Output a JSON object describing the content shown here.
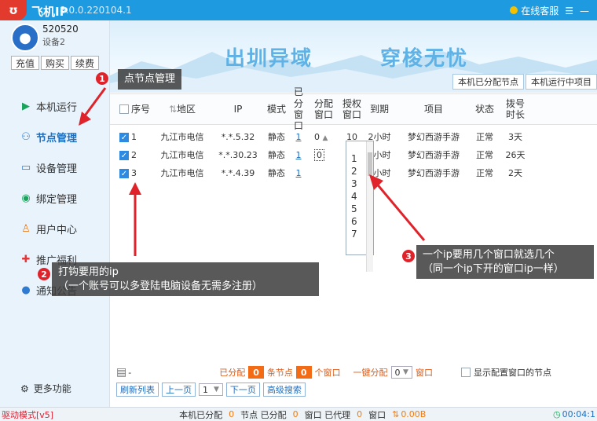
{
  "titlebar": {
    "app_name": "飞机IP",
    "version": "8.0.0.220104.1",
    "service_label": "在线客服"
  },
  "sidebar": {
    "username": "520520",
    "device": "设备2",
    "acct_buttons": [
      "充值",
      "购买",
      "续费"
    ],
    "items": [
      {
        "label": "本机运行",
        "icon": "play-circle-icon"
      },
      {
        "label": "节点管理",
        "icon": "node-tree-icon"
      },
      {
        "label": "设备管理",
        "icon": "device-icon"
      },
      {
        "label": "绑定管理",
        "icon": "link-icon"
      },
      {
        "label": "用户中心",
        "icon": "user-icon"
      },
      {
        "label": "推广福利",
        "icon": "gift-icon"
      },
      {
        "label": "通知公告",
        "icon": "bell-icon"
      }
    ],
    "more_label": "更多功能"
  },
  "banner": {
    "text1": "出圳异域",
    "text2": "穿梭无忧",
    "tabs": [
      "本机已分配节点",
      "本机运行中项目"
    ]
  },
  "table": {
    "headers": [
      {
        "l1": "序号",
        "l2": ""
      },
      {
        "l1": "地区",
        "l2": ""
      },
      {
        "l1": "IP",
        "l2": ""
      },
      {
        "l1": "模式",
        "l2": ""
      },
      {
        "l1": "已分",
        "l2": "窗口"
      },
      {
        "l1": "分配",
        "l2": "窗口"
      },
      {
        "l1": "授权",
        "l2": "窗口"
      },
      {
        "l1": "到期",
        "l2": ""
      },
      {
        "l1": "项目",
        "l2": ""
      },
      {
        "l1": "状态",
        "l2": ""
      },
      {
        "l1": "拨号",
        "l2": "时长"
      }
    ],
    "rows": [
      {
        "no": "1",
        "region": "九江市电信",
        "ip": "*.*.5.32",
        "mode": "静态",
        "assigned": "1",
        "alloc": "0",
        "auth": "10",
        "expire": "2小时",
        "project": "梦幻西游手游",
        "status": "正常",
        "dial": "3天"
      },
      {
        "no": "2",
        "region": "九江市电信",
        "ip": "*.*.30.23",
        "mode": "静态",
        "assigned": "1",
        "alloc": "0",
        "auth": "10",
        "expire": "2小时",
        "project": "梦幻西游手游",
        "status": "正常",
        "dial": "26天"
      },
      {
        "no": "3",
        "region": "九江市电信",
        "ip": "*.*.4.39",
        "mode": "静态",
        "assigned": "1",
        "alloc": "",
        "auth": "10",
        "expire": "2小时",
        "project": "梦幻西游手游",
        "status": "正常",
        "dial": "2天"
      }
    ]
  },
  "dropdown": {
    "options": [
      "0",
      "1",
      "2",
      "3",
      "4",
      "5",
      "6",
      "7"
    ]
  },
  "footer": {
    "assigned_prefix": "已分配",
    "nodes_count": "0",
    "nodes_label": "条节点",
    "windows_count": "0",
    "windows_label": "个窗口",
    "one_click_label": "一键分配",
    "one_click_value": "0",
    "window_unit": "窗口",
    "show_config_label": "显示配置窗口的节点"
  },
  "pager": {
    "refresh": "刷新列表",
    "prev": "上一页",
    "page": "1",
    "next": "下一页",
    "adv": "高级搜索"
  },
  "statusbar": {
    "driver": "驱动模式[v5]",
    "s1": "本机已分配",
    "v1": "0",
    "s2": "节点 已分配",
    "v2": "0",
    "s3": "窗口 已代理",
    "v3": "0",
    "s4": "窗口",
    "speed": "0.00B",
    "time": "00:04:1"
  },
  "callouts": {
    "c1_num": "1",
    "c1_text": "点节点管理",
    "c2_num": "2",
    "c2_line1": "打钩要用的ip",
    "c2_line2": "（一个账号可以多登陆电脑设备无需多注册）",
    "c3_num": "3",
    "c3_line1": "一个ip要用几个窗口就选几个",
    "c3_line2": "（同一个ip下开的窗口ip一样）"
  }
}
